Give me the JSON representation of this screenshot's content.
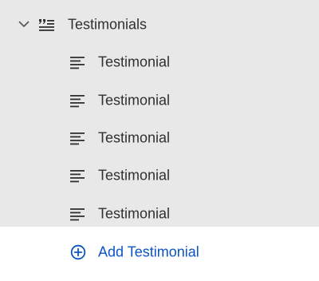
{
  "section": {
    "label": "Testimonials",
    "expanded": true,
    "icon": "quote-list-icon",
    "toggle_icon": "chevron-down-icon"
  },
  "blocks": [
    {
      "label": "Testimonial",
      "icon": "text-lines-icon"
    },
    {
      "label": "Testimonial",
      "icon": "text-lines-icon"
    },
    {
      "label": "Testimonial",
      "icon": "text-lines-icon"
    },
    {
      "label": "Testimonial",
      "icon": "text-lines-icon"
    },
    {
      "label": "Testimonial",
      "icon": "text-lines-icon"
    }
  ],
  "add_block": {
    "label": "Add Testimonial",
    "icon": "plus-circle-icon"
  },
  "colors": {
    "panel_background": "#e8e8e8",
    "add_area_background": "#ffffff",
    "text": "#303030",
    "accent": "#0b55c6"
  }
}
